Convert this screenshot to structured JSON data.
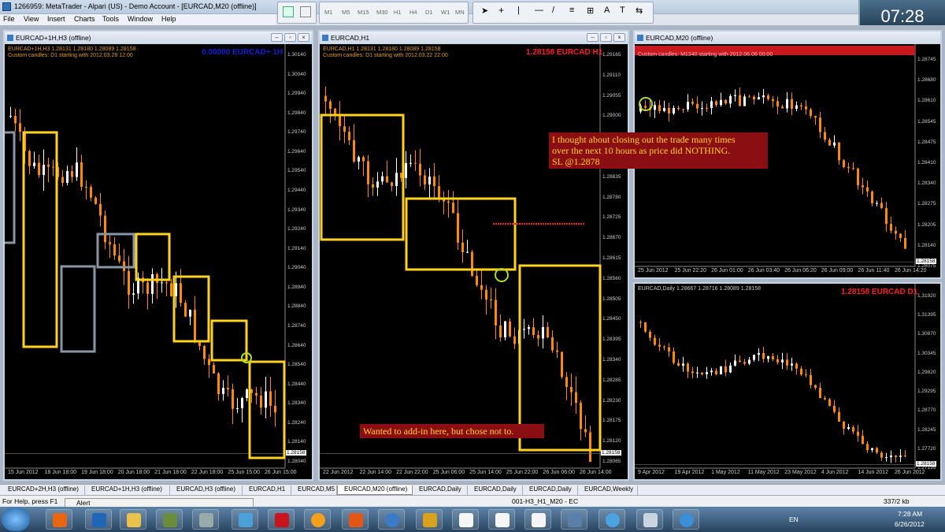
{
  "window": {
    "title": "1266959: MetaTrader - Alpari (US) - Demo Account - [EURCAD,M20 (offline)]"
  },
  "menu": [
    "File",
    "View",
    "Insert",
    "Charts",
    "Tools",
    "Window",
    "Help"
  ],
  "periods": [
    "M1",
    "M5",
    "M15",
    "M30",
    "H1",
    "H4",
    "D1",
    "W1",
    "MN"
  ],
  "clock": "07:28",
  "charts": [
    {
      "id": "w1",
      "caption": "EURCAD+1H,H3 (offline)",
      "info1": "EURCAD+1H,H3  1.28131 1.28180 1.28089 1.28158",
      "info2": "Custom candles: D1 starting with 2012.03.28 12:00",
      "header": "0.00000 EURCAD+ 1H",
      "header_color": "#1020d0",
      "yticks": [
        "1.30140",
        "1.30040",
        "1.29940",
        "1.29840",
        "1.29740",
        "1.29640",
        "1.29540",
        "1.29440",
        "1.29340",
        "1.29240",
        "1.29140",
        "1.29040",
        "1.28940",
        "1.28840",
        "1.28740",
        "1.28640",
        "1.28540",
        "1.28440",
        "1.28340",
        "1.28240",
        "1.28140",
        "1.28040"
      ],
      "xticks": [
        "15 Jun 2012",
        "18 Jun 18:00",
        "19 Jun 18:00",
        "20 Jun 18:00",
        "21 Jun 18:00",
        "22 Jun 18:00",
        "25 Jun 15:00",
        "26 Jun 15:00"
      ],
      "current_price": "1.28158"
    },
    {
      "id": "w2",
      "caption": "EURCAD,H1",
      "info1": "EURCAD,H1  1.28131 1.28180 1.28089 1.28158",
      "info2": "Custom candles: D1 starting with 2012.03.22 22:00",
      "header": "1.28158 EURCAD H1",
      "header_color": "#ff2020",
      "yticks": [
        "1.29165",
        "1.29110",
        "1.29055",
        "1.29000",
        "1.28945",
        "1.28890",
        "1.28835",
        "1.28780",
        "1.28725",
        "1.28670",
        "1.28615",
        "1.28560",
        "1.28505",
        "1.28450",
        "1.28395",
        "1.28340",
        "1.28285",
        "1.28230",
        "1.28175",
        "1.28120",
        "1.28065"
      ],
      "xticks": [
        "22 Jun 2012",
        "22 Jun 14:00",
        "22 Jun 22:00",
        "25 Jun 06:00",
        "25 Jun 14:00",
        "25 Jun 22:00",
        "26 Jun 06:00",
        "26 Jun 14:00"
      ],
      "current_price": "1.28158"
    },
    {
      "id": "w3",
      "caption": "EURCAD,M20 (offline)",
      "info1": "",
      "info2": "Custom candles: M1340 starting with 2012.06.06 00:00",
      "header": "",
      "header_color": "#ff2020",
      "yticks": [
        "1.28745",
        "1.28680",
        "1.28610",
        "1.28545",
        "1.28475",
        "1.28410",
        "1.28340",
        "1.28275",
        "1.28205",
        "1.28140",
        "1.28075"
      ],
      "xticks": [
        "25 Jun 2012",
        "25 Jun 22:20",
        "26 Jun 01:00",
        "26 Jun 03:40",
        "26 Jun 06:20",
        "26 Jun 09:00",
        "26 Jun 11:40",
        "26 Jun 14:20"
      ],
      "current_price": "1.28158"
    },
    {
      "id": "w4",
      "caption": "",
      "info1": "EURCAD,Daily  1.28667 1.28716 1.28089 1.28158",
      "info2": "",
      "header": "1.28158 EURCAD D1",
      "header_color": "#ff2020",
      "yticks": [
        "1.31920",
        "1.31395",
        "1.30870",
        "1.30345",
        "1.29820",
        "1.29295",
        "1.28770",
        "1.28245",
        "1.27720",
        "1.27195"
      ],
      "xticks": [
        "9 Apr 2012",
        "19 Apr 2012",
        "1 May 2012",
        "11 May 2012",
        "23 May 2012",
        "4 Jun 2012",
        "14 Jun 2012",
        "26 Jun 2012"
      ],
      "current_price": "1.28158"
    }
  ],
  "notes": {
    "sl_note_line1": "I thought about closing out the trade many times",
    "sl_note_line2": "over the next 10 hours as price did NOTHING.",
    "sl_note_line3": "SL @1.2878",
    "addin_note": "Wanted to add-in here, but chose not to."
  },
  "tabs": [
    "EURCAD+2H,H3 (offline)",
    "EURCAD+1H,H3 (offline)",
    "EURCAD,H3 (offline)",
    "EURCAD,H1",
    "EURCAD,M5",
    "EURCAD,M20 (offline)",
    "EURCAD,Daily",
    "EURCAD,Daily",
    "EURCAD,Daily",
    "EURCAD,Weekly"
  ],
  "status": {
    "help": "For Help, press F1",
    "alert": "Alert",
    "profile": "001-H3_H1_M20 - EC",
    "traffic": "337/2 kb"
  },
  "tray": {
    "lang": "EN",
    "time": "7:28 AM",
    "date": "6/26/2012"
  },
  "colors": {
    "bull": "#ffffff",
    "bear": "#ff8c00",
    "box_yellow": "#ffd21f",
    "box_grey": "#8a96a3"
  }
}
